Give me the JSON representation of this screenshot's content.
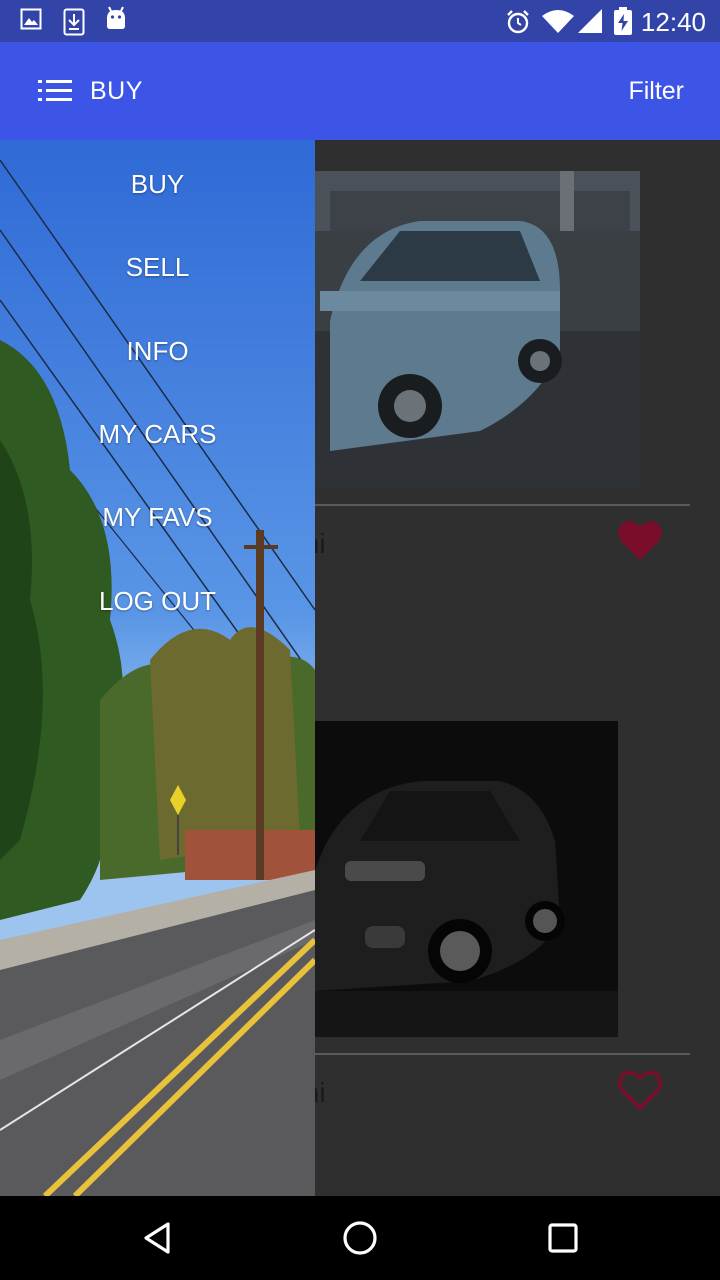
{
  "status_bar": {
    "time": "12:40",
    "left_icons": [
      "gallery-icon",
      "download-icon",
      "android-icon"
    ],
    "right_icons": [
      "alarm-icon",
      "wifi-icon",
      "signal-icon",
      "battery-charging-icon"
    ]
  },
  "app_bar": {
    "menu_icon": "list-menu-icon",
    "title": "BUY",
    "filter_label": "Filter"
  },
  "drawer": {
    "items": [
      {
        "label": "BUY"
      },
      {
        "label": "SELL"
      },
      {
        "label": "INFO"
      },
      {
        "label": "MY CARS"
      },
      {
        "label": "MY FAVS"
      },
      {
        "label": "LOG OUT"
      }
    ]
  },
  "listings": [
    {
      "visible_text": "mi",
      "favorited": true,
      "photo": "blue-sedan-photo"
    },
    {
      "visible_text": "mi",
      "favorited": false,
      "photo": "black-sedan-photo"
    }
  ],
  "colors": {
    "status_bar": "#3344a8",
    "app_bar": "#3d55e6",
    "scrim_content": "#2f2f2f",
    "heart": "#7a0e2a"
  },
  "nav_bar": {
    "buttons": [
      "back-icon",
      "home-icon",
      "recents-icon"
    ]
  }
}
